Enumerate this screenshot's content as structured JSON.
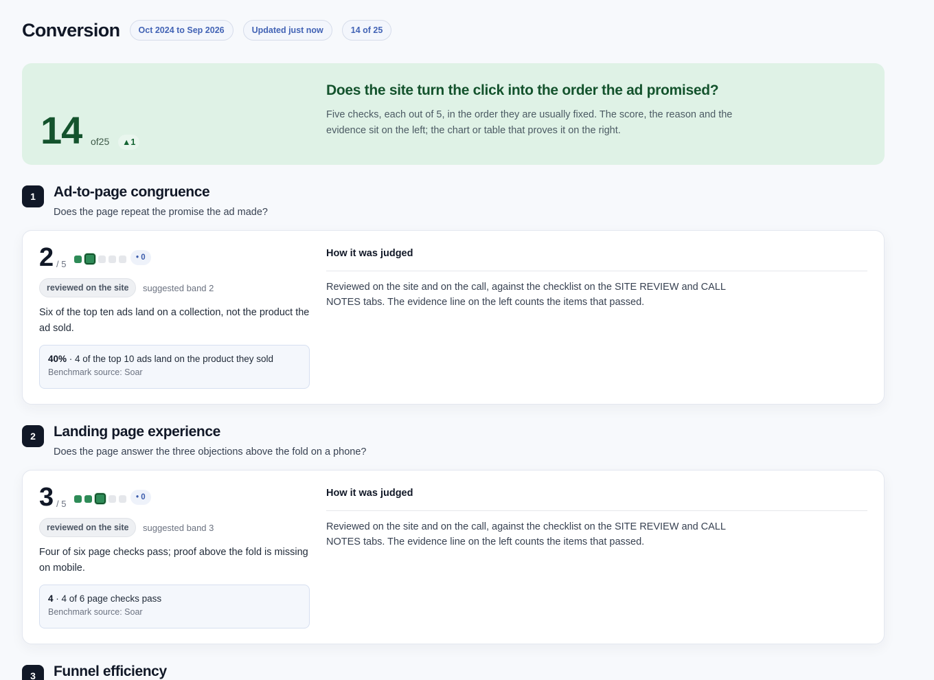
{
  "header": {
    "title": "Conversion",
    "chips": [
      "Oct 2024 to Sep 2026",
      "Updated just now",
      "14 of 25"
    ]
  },
  "hero": {
    "score": "14",
    "of": "of25",
    "delta": "▲1",
    "question": "Does the site turn the click into the order the ad promised?",
    "description": "Five checks, each out of 5, in the order they are usually fixed. The score, the reason and the evidence sit on the left; the chart or table that proves it on the right."
  },
  "sections": [
    {
      "number": "1",
      "title": "Ad-to-page congruence",
      "subtitle": "Does the page repeat the promise the ad made?",
      "score": "2",
      "score_of": "/ 5",
      "rating": 2,
      "rating_max": 5,
      "delta": "• 0",
      "method": "reviewed on the site",
      "band": "suggested band 2",
      "reason": "Six of the top ten ads land on a collection, not the product the ad sold.",
      "evidence_value": "40%",
      "evidence_text": " · 4 of the top 10 ads land on the product they sold",
      "evidence_source": "Benchmark source: Soar",
      "judged_heading": "How it was judged",
      "judged_text": "Reviewed on the site and on the call, against the checklist on the SITE REVIEW and CALL NOTES tabs. The evidence line on the left counts the items that passed."
    },
    {
      "number": "2",
      "title": "Landing page experience",
      "subtitle": "Does the page answer the three objections above the fold on a phone?",
      "score": "3",
      "score_of": "/ 5",
      "rating": 3,
      "rating_max": 5,
      "delta": "• 0",
      "method": "reviewed on the site",
      "band": "suggested band 3",
      "reason": "Four of six page checks pass; proof above the fold is missing on mobile.",
      "evidence_value": "4",
      "evidence_text": " · 4 of 6 page checks pass",
      "evidence_source": "Benchmark source: Soar",
      "judged_heading": "How it was judged",
      "judged_text": "Reviewed on the site and on the call, against the checklist on the SITE REVIEW and CALL NOTES tabs. The evidence line on the left counts the items that passed."
    },
    {
      "number": "3",
      "title": "Funnel efficiency"
    }
  ]
}
